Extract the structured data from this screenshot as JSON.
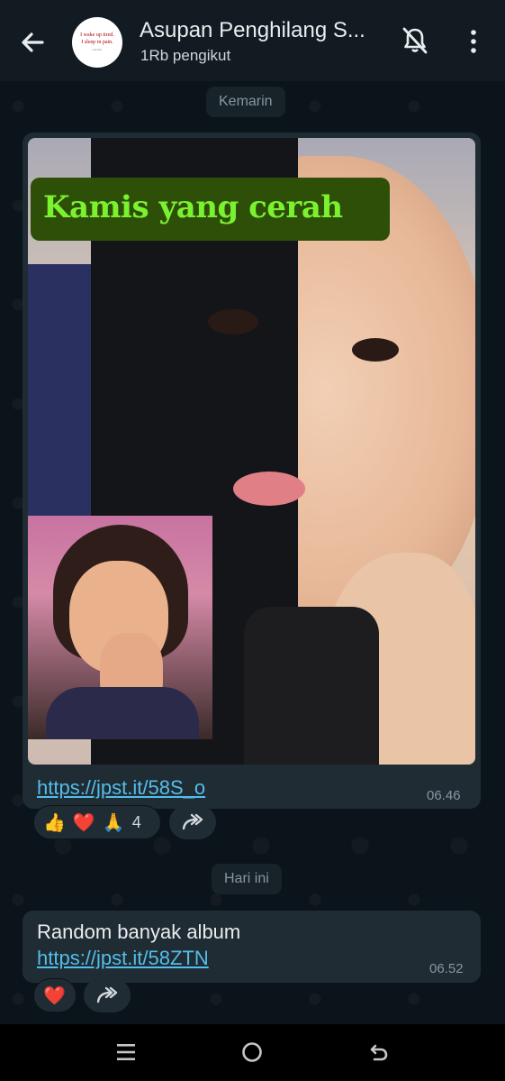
{
  "header": {
    "title": "Asupan Penghilang S...",
    "subtitle": "1Rb pengikut",
    "avatar_text": [
      "I wake up tired.",
      "I sleep in pain.",
      "Labrador"
    ]
  },
  "date_chips": {
    "yesterday": "Kemarin",
    "today": "Hari ini"
  },
  "message1": {
    "overlay_title": "Kamis yang cerah",
    "link": "https://jpst.it/58S_o",
    "time": "06.46",
    "reactions": [
      "👍",
      "❤️",
      "🙏"
    ],
    "reaction_count": "4"
  },
  "message2": {
    "text": "Random banyak album",
    "link": "https://jpst.it/58ZTN",
    "time": "06.52",
    "reactions": [
      "❤️"
    ]
  },
  "colors": {
    "header_bg": "#111b21",
    "chat_bg": "#0b141a",
    "bubble_bg": "#202c33",
    "link": "#53bdeb",
    "overlay_bg": "#2e4f08",
    "overlay_text": "#7bf230"
  },
  "icons": [
    "back-arrow-icon",
    "mute-bell-icon",
    "kebab-menu-icon",
    "forward-icon",
    "nav-recents-icon",
    "nav-home-icon",
    "nav-back-icon"
  ]
}
